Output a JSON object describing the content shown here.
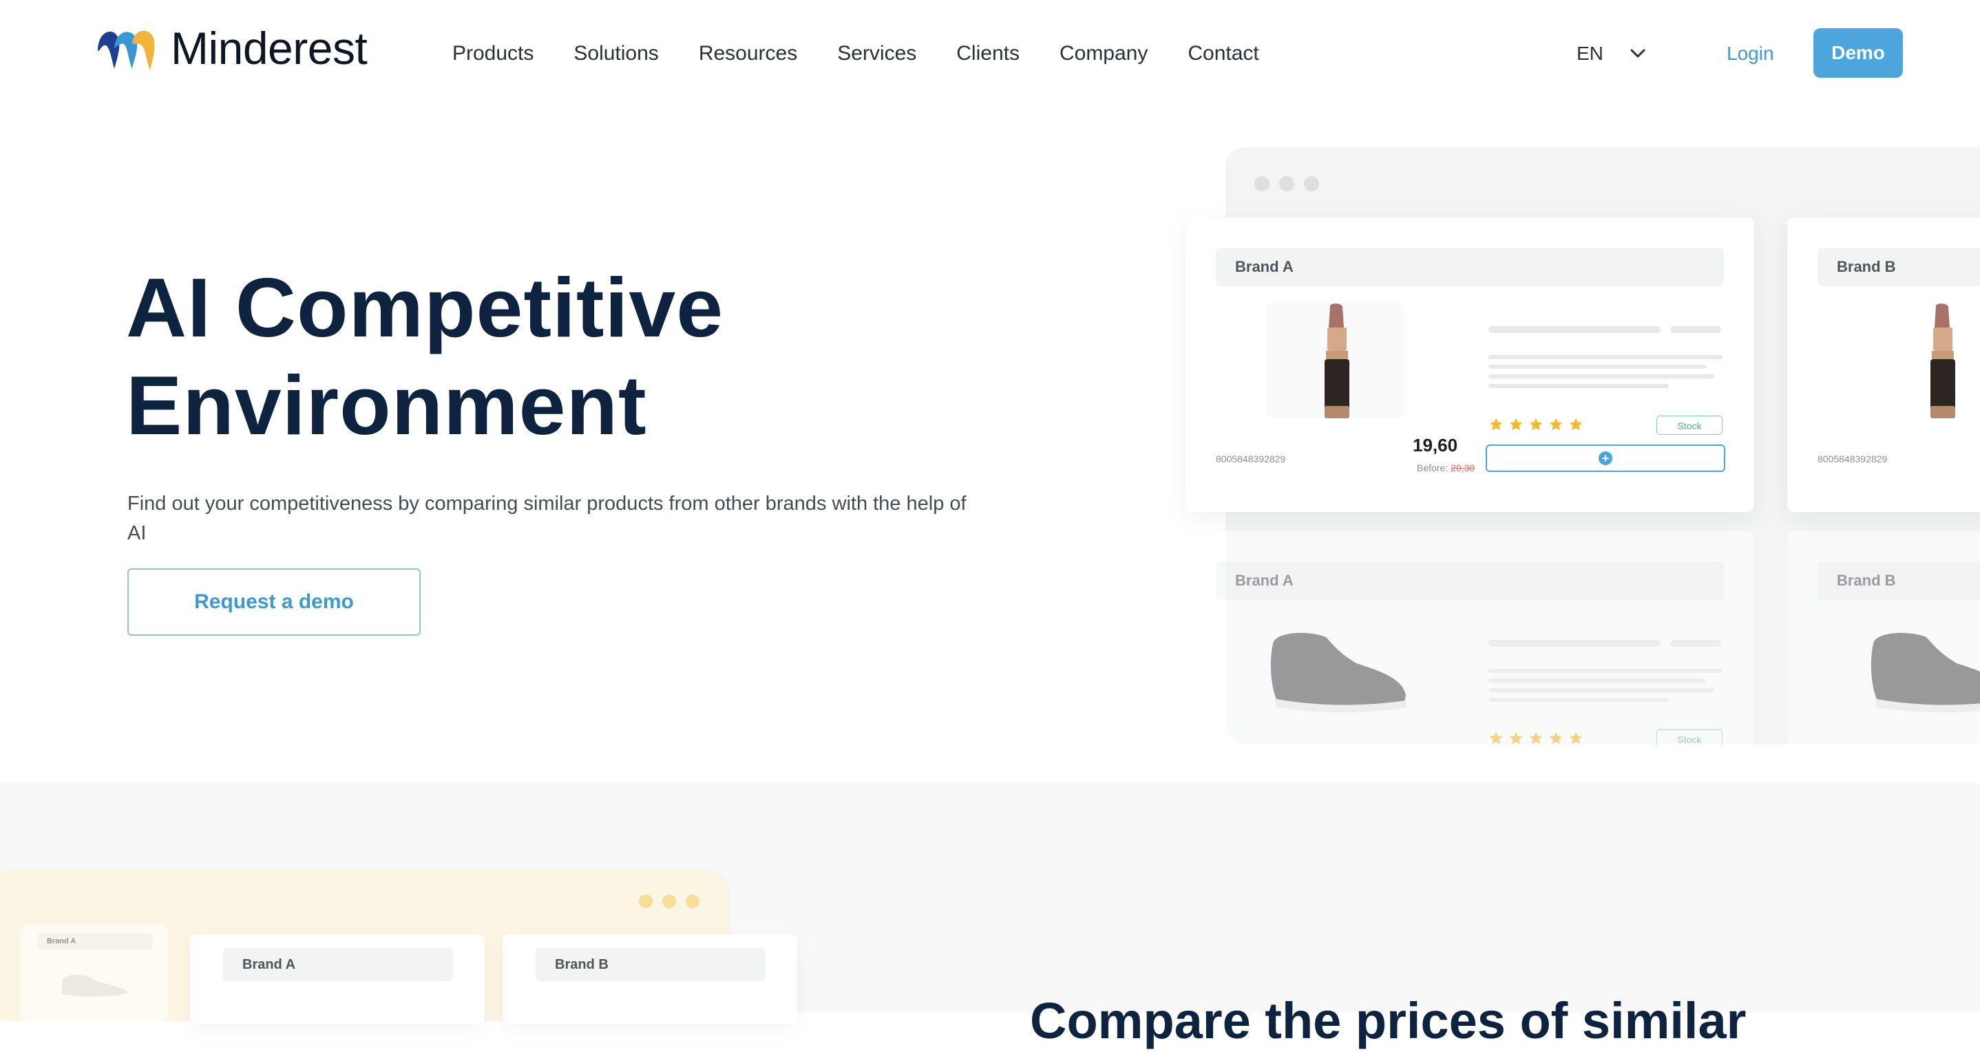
{
  "brand": {
    "name": "Minderest"
  },
  "nav": {
    "items": [
      {
        "label": "Products"
      },
      {
        "label": "Solutions"
      },
      {
        "label": "Resources"
      },
      {
        "label": "Services"
      },
      {
        "label": "Clients"
      },
      {
        "label": "Company"
      },
      {
        "label": "Contact"
      }
    ],
    "language": "EN",
    "login_label": "Login",
    "demo_label": "Demo"
  },
  "hero": {
    "title_line1": "AI Competitive",
    "title_line2": "Environment",
    "subtitle": "Find out your competitiveness by comparing similar products from other brands with the help of AI",
    "cta_label": "Request a demo"
  },
  "mockup": {
    "cards": [
      {
        "brand": "Brand A",
        "sku": "8005848392829",
        "price": "19,60",
        "before_label": "Before:",
        "before_price": "20,30",
        "stock": "Stock",
        "rating": 5
      },
      {
        "brand": "Brand B",
        "sku": "8005848392829"
      },
      {
        "brand": "Brand A",
        "stock": "Stock",
        "rating": 5
      },
      {
        "brand": "Brand B"
      }
    ]
  },
  "section2": {
    "title": "Compare the prices of similar",
    "mini_cards": [
      {
        "brand": "Brand A"
      },
      {
        "brand": "Brand A"
      },
      {
        "brand": "Brand B"
      }
    ]
  },
  "colors": {
    "accent": "#4ca6de",
    "heading": "#0e2340",
    "star": "#f5b92e",
    "stock": "#3fb487"
  }
}
